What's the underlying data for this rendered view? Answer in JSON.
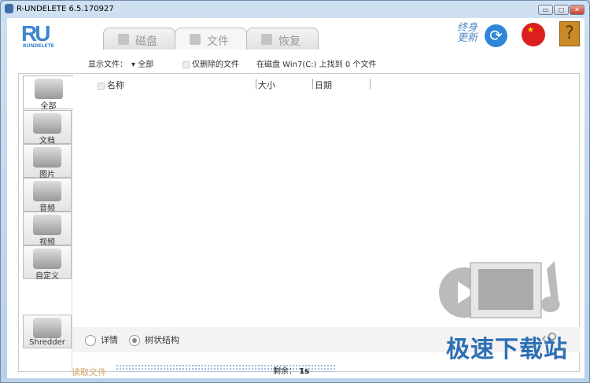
{
  "window": {
    "title": "R-UNDELETE 6.5.170927",
    "minimize": "▭",
    "maximize": "▢",
    "close": "✕"
  },
  "logo": {
    "text": "RU",
    "subtext": "RUNDELETE"
  },
  "tabs": [
    {
      "label": "磁盘"
    },
    {
      "label": "文件",
      "active": true
    },
    {
      "label": "恢复"
    }
  ],
  "header": {
    "update": [
      "终身",
      "更新"
    ],
    "help": "?",
    "flag_star": "★"
  },
  "filter": {
    "show_label": "显示文件：",
    "show_value": "全部",
    "deleted_only": "仅删除的文件",
    "found_text": "在磁盘 Win7(C:) 上找到 0 个文件"
  },
  "categories": [
    {
      "label": "全部"
    },
    {
      "label": "文档"
    },
    {
      "label": "图片"
    },
    {
      "label": "音频"
    },
    {
      "label": "视频"
    },
    {
      "label": "自定义"
    },
    {
      "label": "Shredder"
    }
  ],
  "columns": [
    "名称",
    "大小",
    "日期"
  ],
  "view": {
    "detail": "详情",
    "tree": "树状结构",
    "selected": "tree"
  },
  "status": {
    "reading": "读取文件",
    "remaining": "剩余：",
    "remaining_value": "1s"
  },
  "watermark": "极速下载站",
  "colors": {
    "accent": "#3f86cf",
    "watermark": "#2d6fb4"
  }
}
